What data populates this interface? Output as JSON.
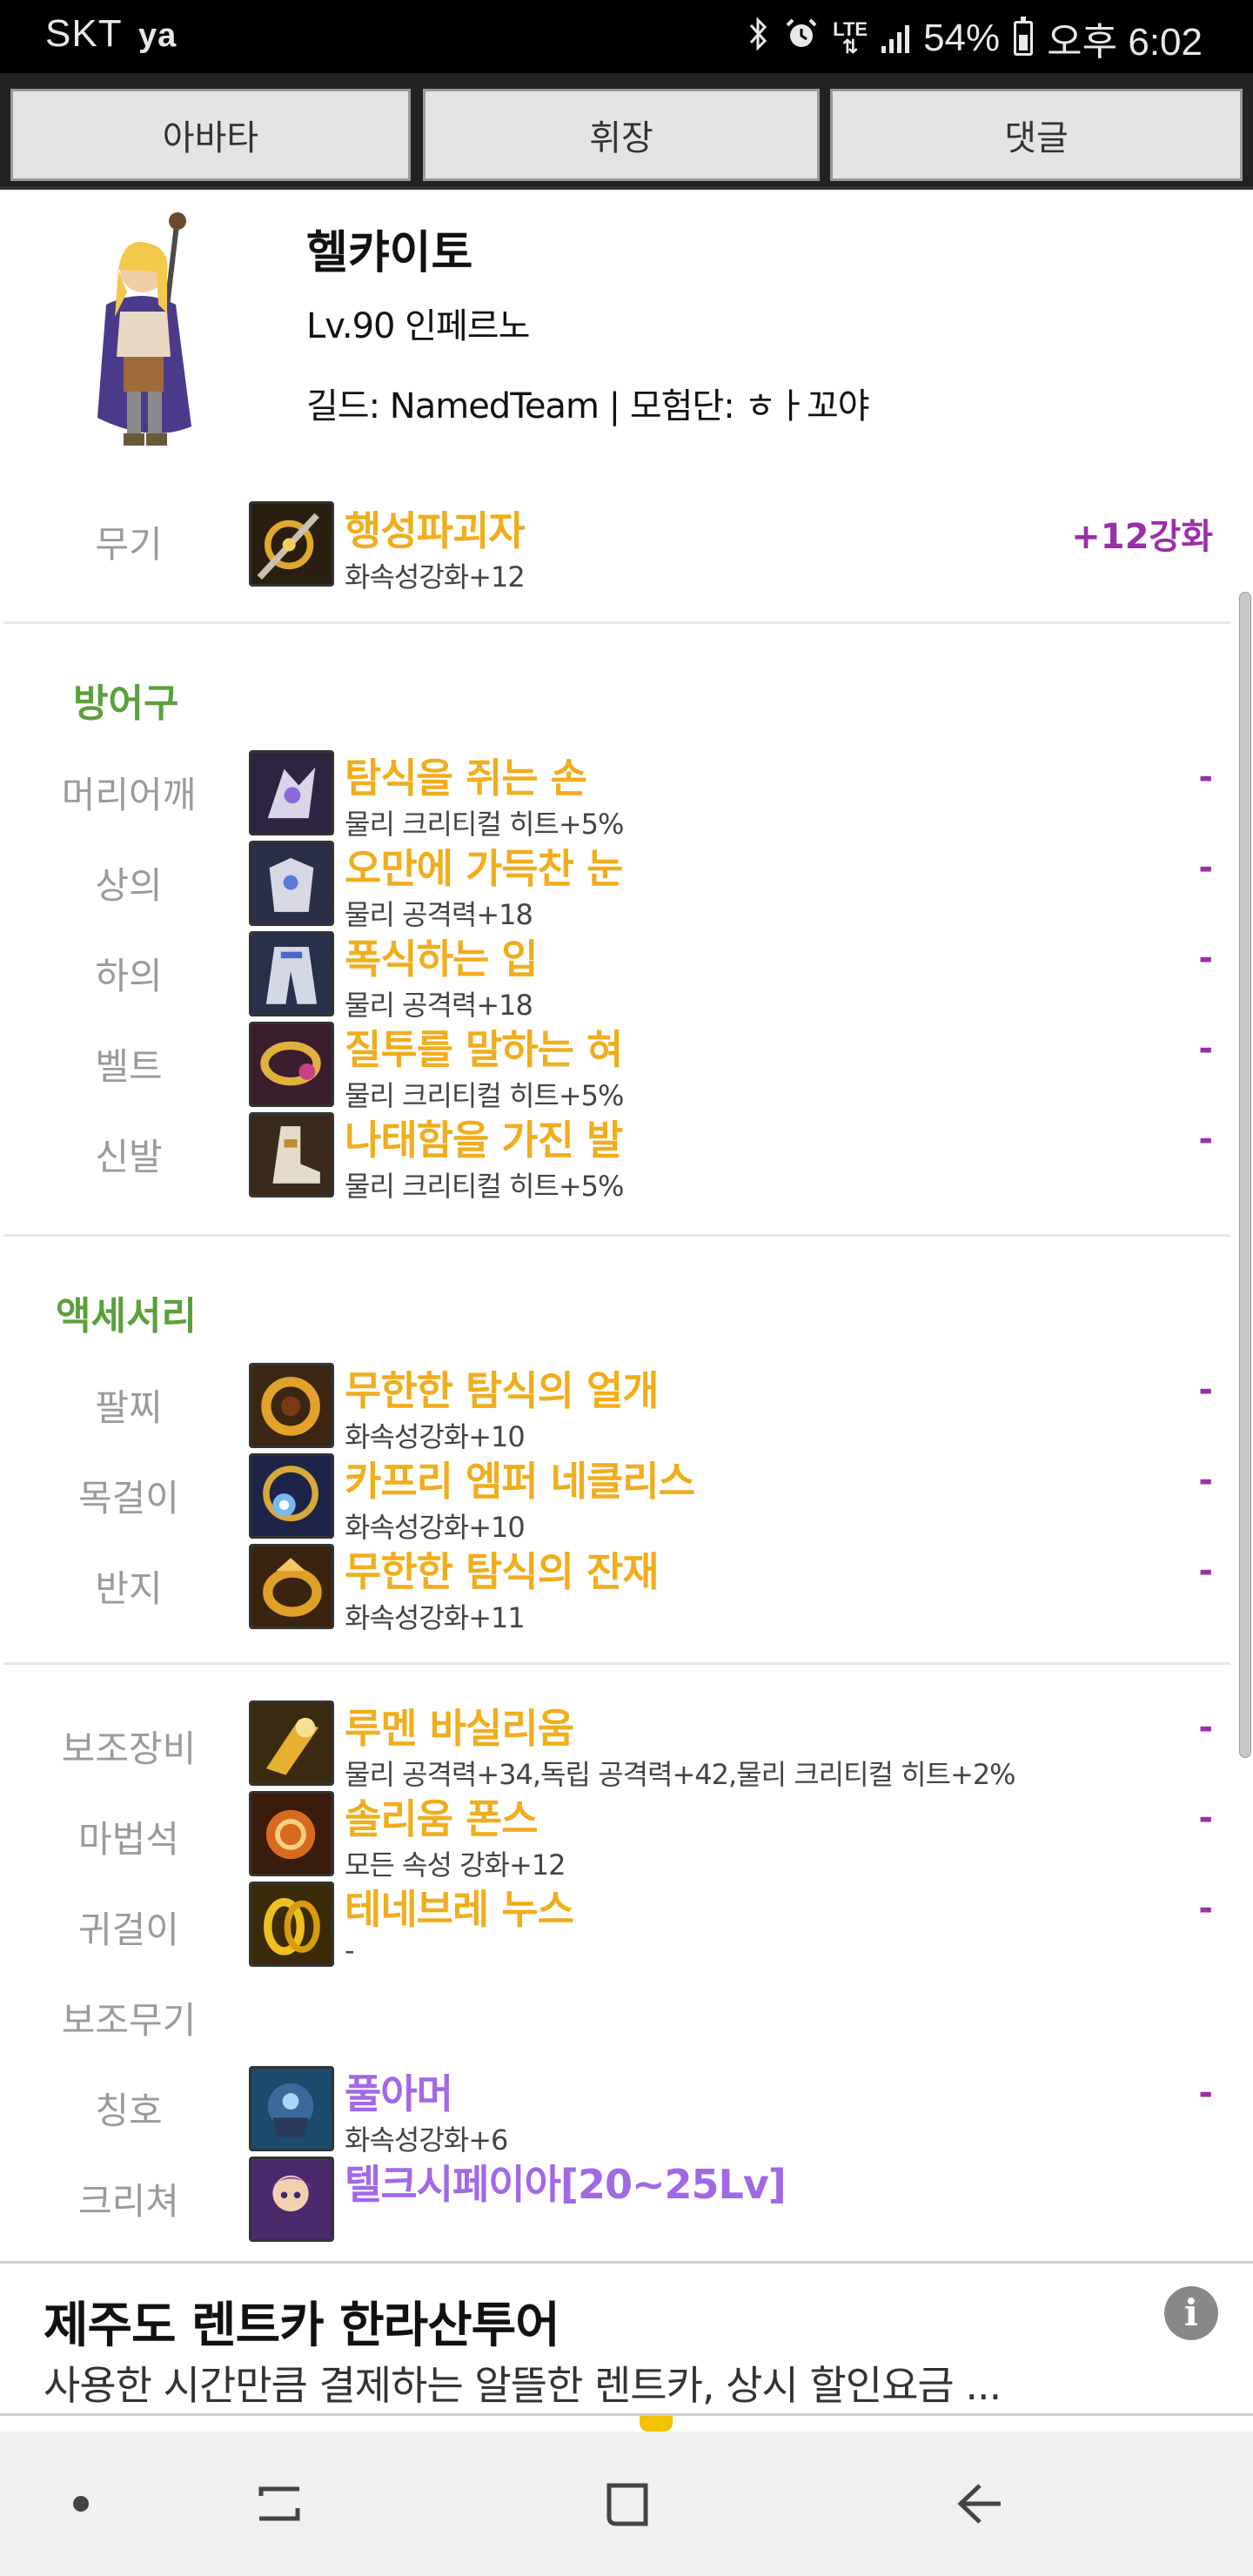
{
  "status_bar": {
    "carrier": "SKT",
    "carrier_badge": "ya",
    "network": "LTE",
    "battery_percent": "54%",
    "time": "오후 6:02",
    "battery_level": 0.54
  },
  "tabs": [
    {
      "label": "아바타"
    },
    {
      "label": "휘장"
    },
    {
      "label": "댓글"
    }
  ],
  "profile": {
    "name": "헬캬이토",
    "level": "Lv.90 인페르노",
    "guild": "길드: NamedTeam | 모험단: ㅎㅏ꼬야"
  },
  "weapon": {
    "slot": "무기",
    "name": "행성파괴자",
    "stat": "화속성강화+12",
    "enhance": "+12강화"
  },
  "armor_section": {
    "title": "방어구",
    "items": [
      {
        "slot": "머리어깨",
        "name": "탐식을 쥐는 손",
        "stat": "물리 크리티컬 히트+5%",
        "value": "-"
      },
      {
        "slot": "상의",
        "name": "오만에 가득찬 눈",
        "stat": "물리 공격력+18",
        "value": "-"
      },
      {
        "slot": "하의",
        "name": "폭식하는 입",
        "stat": "물리 공격력+18",
        "value": "-"
      },
      {
        "slot": "벨트",
        "name": "질투를 말하는 혀",
        "stat": "물리 크리티컬 히트+5%",
        "value": "-"
      },
      {
        "slot": "신발",
        "name": "나태함을 가진 발",
        "stat": "물리 크리티컬 히트+5%",
        "value": "-"
      }
    ]
  },
  "accessory_section": {
    "title": "액세서리",
    "items": [
      {
        "slot": "팔찌",
        "name": "무한한 탐식의 얼개",
        "stat": "화속성강화+10",
        "value": "-"
      },
      {
        "slot": "목걸이",
        "name": "카프리 엠퍼 네클리스",
        "stat": "화속성강화+10",
        "value": "-"
      },
      {
        "slot": "반지",
        "name": "무한한 탐식의 잔재",
        "stat": "화속성강화+11",
        "value": "-"
      }
    ]
  },
  "special_section": {
    "items": [
      {
        "slot": "보조장비",
        "name": "루멘 바실리움",
        "stat": "물리 공격력+34,독립 공격력+42,물리 크리티컬 히트+2%",
        "value": "-"
      },
      {
        "slot": "마법석",
        "name": "솔리움 폰스",
        "stat": "모든 속성 강화+12",
        "value": "-"
      },
      {
        "slot": "귀걸이",
        "name": "테네브레 누스",
        "stat": "-",
        "value": "-"
      }
    ],
    "sub_weapon_slot": "보조무기",
    "title_item": {
      "slot": "칭호",
      "name": "풀아머",
      "stat": "화속성강화+6",
      "value": "-"
    },
    "creature_item": {
      "slot": "크리쳐",
      "name": "텔크시페이아[20~25Lv]"
    }
  },
  "ad": {
    "title": "제주도 렌트카 한라산투어",
    "description": "사용한 시간만큼 결제하는 알뜰한 렌트카, 상시 할인요금 ...",
    "info_icon": "i"
  },
  "nav": {
    "icons": [
      "dot-icon",
      "recent-apps-icon",
      "home-icon",
      "back-icon"
    ]
  },
  "colors": {
    "item_name": "#f0ad1c",
    "item_name_rare": "#a268e6",
    "enhance": "#9b2fa8",
    "section_title": "#5aa03c",
    "slot_label": "#9a9a9a"
  }
}
